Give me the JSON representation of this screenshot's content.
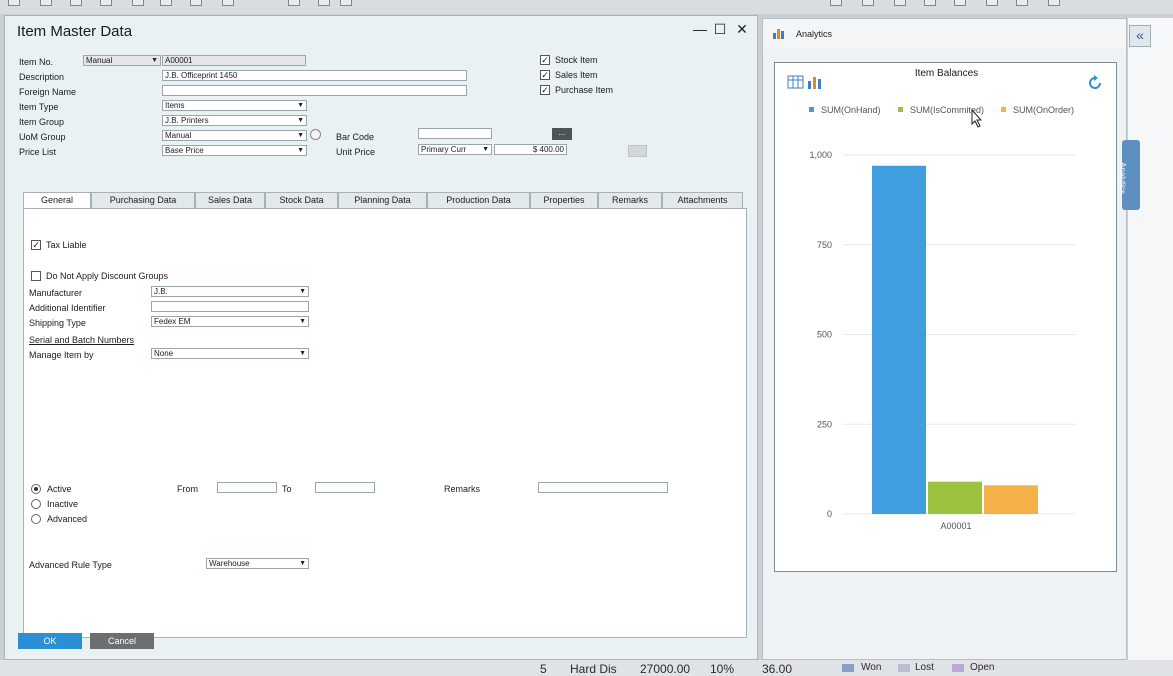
{
  "window": {
    "title": "Item Master Data",
    "controls": {
      "minimize": "—",
      "maximize": "☐",
      "close": "✕"
    }
  },
  "header": {
    "item_no_label": "Item No.",
    "item_no_series": "Manual",
    "item_no_value": "A00001",
    "description_label": "Description",
    "description_value": "J.B. Officeprint 1450",
    "foreign_name_label": "Foreign Name",
    "foreign_name_value": "",
    "item_type_label": "Item Type",
    "item_type_value": "Items",
    "item_group_label": "Item Group",
    "item_group_value": "J.B. Printers",
    "uom_group_label": "UoM Group",
    "uom_group_value": "Manual",
    "price_list_label": "Price List",
    "price_list_value": "Base Price",
    "bar_code_label": "Bar Code",
    "bar_code_value": "",
    "bar_code_button": "...",
    "unit_price_label": "Unit Price",
    "unit_price_currency": "Primary Curr",
    "unit_price_value": "$ 400.00",
    "stock_item_label": "Stock Item",
    "sales_item_label": "Sales Item",
    "purchase_item_label": "Purchase Item"
  },
  "tabs": [
    {
      "label": "General"
    },
    {
      "label": "Purchasing Data"
    },
    {
      "label": "Sales Data"
    },
    {
      "label": "Stock Data"
    },
    {
      "label": "Planning Data"
    },
    {
      "label": "Production Data"
    },
    {
      "label": "Properties"
    },
    {
      "label": "Remarks"
    },
    {
      "label": "Attachments"
    }
  ],
  "general": {
    "tax_liable_label": "Tax Liable",
    "no_discount_label": "Do Not Apply Discount Groups",
    "manufacturer_label": "Manufacturer",
    "manufacturer_value": "J.B.",
    "additional_identifier_label": "Additional Identifier",
    "additional_identifier_value": "",
    "shipping_type_label": "Shipping Type",
    "shipping_type_value": "Fedex EM",
    "serial_batch_label": "Serial and Batch Numbers",
    "manage_item_by_label": "Manage Item by",
    "manage_item_by_value": "None",
    "active_label": "Active",
    "inactive_label": "Inactive",
    "advanced_label": "Advanced",
    "from_label": "From",
    "to_label": "To",
    "remarks_label": "Remarks",
    "advanced_rule_type_label": "Advanced Rule Type",
    "advanced_rule_type_value": "Warehouse"
  },
  "footer": {
    "ok_label": "OK",
    "cancel_label": "Cancel"
  },
  "analytics": {
    "panel_title": "Analytics",
    "side_tab_label": "Analytics",
    "collapse_label": "«"
  },
  "bottom_strip": {
    "quantity": "5",
    "item_label": "Hard Dis",
    "amount": "27000.00",
    "percent": "10%",
    "value": "36.00",
    "won_label": "Won",
    "lost_label": "Lost",
    "open_label": "Open"
  },
  "colors": {
    "accent": "#2b8fd6",
    "on_hand": "#3f9ee0",
    "is_committed": "#9cc33f",
    "on_order": "#f5b04a",
    "cancel": "#6b6f72"
  },
  "chart_data": {
    "type": "bar",
    "title": "Item Balances",
    "categories": [
      "A00001"
    ],
    "series": [
      {
        "name": "SUM(OnHand)",
        "values": [
          970
        ]
      },
      {
        "name": "SUM(IsCommited)",
        "values": [
          90
        ]
      },
      {
        "name": "SUM(OnOrder)",
        "values": [
          80
        ]
      }
    ],
    "yticks": [
      "0",
      "250",
      "500",
      "750",
      "1,000"
    ],
    "ylim": [
      0,
      1000
    ],
    "grid": true,
    "legend": "top"
  }
}
